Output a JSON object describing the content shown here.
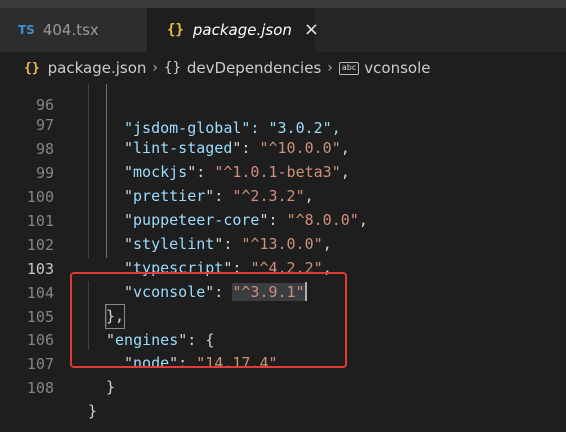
{
  "tabs": [
    {
      "icon": "TS",
      "label": "404.tsx",
      "active": false
    },
    {
      "icon": "{}",
      "label": "package.json",
      "active": true,
      "close": "×"
    }
  ],
  "breadcrumb": {
    "items": [
      {
        "icon": "{}",
        "label": "package.json"
      },
      {
        "icon": "{}",
        "label": "devDependencies"
      },
      {
        "icon": "abc",
        "label": "vconsole"
      }
    ],
    "separator": "›"
  },
  "editor": {
    "partial_line": {
      "number": "96",
      "text": "\"jsdom-global\": \"3.0.2\","
    },
    "lines": [
      {
        "number": "97",
        "key": "lint-staged",
        "value": "^10.0.0"
      },
      {
        "number": "98",
        "key": "mockjs",
        "value": "^1.0.1-beta3"
      },
      {
        "number": "99",
        "key": "prettier",
        "value": "^2.3.2"
      },
      {
        "number": "100",
        "key": "puppeteer-core",
        "value": "^8.0.0"
      },
      {
        "number": "101",
        "key": "stylelint",
        "value": "^13.0.0"
      },
      {
        "number": "102",
        "key": "typescript",
        "value": "^4.2.2"
      },
      {
        "number": "103",
        "key": "vconsole",
        "value": "^3.9.1"
      }
    ],
    "line104": {
      "number": "104",
      "text": "},"
    },
    "line105": {
      "number": "105",
      "key": "engines",
      "text": ": {"
    },
    "line106": {
      "number": "106",
      "key": "node",
      "value": "14.17.4"
    },
    "line107": {
      "number": "107",
      "text": "}"
    },
    "line108": {
      "number": "108",
      "text": "}"
    }
  },
  "colors": {
    "key": "#9cdcfe",
    "string": "#ce9178",
    "highlight_box": "#e23a36",
    "ts_icon": "#3b8fd0",
    "json_icon": "#e8c145"
  }
}
